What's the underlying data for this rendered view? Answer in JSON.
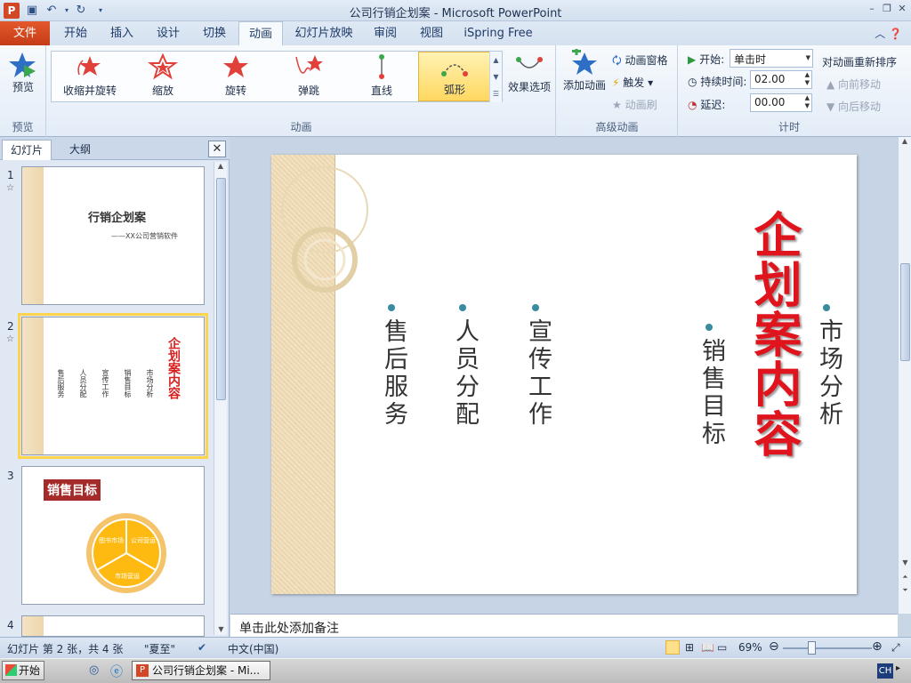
{
  "window": {
    "title": "公司行销企划案 - Microsoft PowerPoint",
    "app_icon_letter": "P",
    "controls": {
      "minimize": "–",
      "restore": "❐",
      "close": "✕"
    }
  },
  "ribbon_tabs": {
    "file": "文件",
    "items": [
      "开始",
      "插入",
      "设计",
      "切换",
      "动画",
      "幻灯片放映",
      "审阅",
      "视图",
      "iSpring Free"
    ],
    "active_index": 4
  },
  "ribbon": {
    "preview": {
      "button": "预览",
      "group": "预览"
    },
    "animation_gallery": {
      "items": [
        {
          "label": "收缩并旋转",
          "icon": "shrink-spin-icon"
        },
        {
          "label": "缩放",
          "icon": "zoom-star-icon"
        },
        {
          "label": "旋转",
          "icon": "spin-star-icon"
        },
        {
          "label": "弹跳",
          "icon": "bounce-star-icon"
        },
        {
          "label": "直线",
          "icon": "line-path-icon"
        },
        {
          "label": "弧形",
          "icon": "arc-path-icon"
        }
      ],
      "selected_index": 5,
      "effect_options": "效果选项",
      "group": "动画"
    },
    "advanced": {
      "add_animation": "添加动画",
      "animation_pane": "动画窗格",
      "trigger": "触发",
      "animation_painter": "动画刷",
      "group": "高级动画"
    },
    "timing": {
      "start_label": "开始:",
      "start_value": "单击时",
      "duration_label": "持续时间:",
      "duration_value": "02.00",
      "delay_label": "延迟:",
      "delay_value": "00.00",
      "reorder_title": "对动画重新排序",
      "move_earlier": "向前移动",
      "move_later": "向后移动",
      "group": "计时"
    }
  },
  "panel": {
    "tab_slides": "幻灯片",
    "tab_outline": "大纲",
    "close": "✕",
    "thumbs": [
      {
        "num": "1",
        "title": "行销企划案",
        "subtitle": "——XX公司营销软件"
      },
      {
        "num": "2",
        "big_title": "企划案内容",
        "columns": [
          "售后服务",
          "人员分配",
          "宣传工作",
          "销售目标",
          "市场分析"
        ]
      },
      {
        "num": "3",
        "title": "销售目标",
        "pie_labels": [
          "图书市场",
          "公司营运",
          "市场营运"
        ]
      },
      {
        "num": "4"
      }
    ],
    "selected_num": "2"
  },
  "slide": {
    "big_title": "企划案内容",
    "columns": [
      "售后服务",
      "人员分配",
      "宣传工作",
      "销售目标",
      "市场分析"
    ]
  },
  "notes_placeholder": "单击此处添加备注",
  "status": {
    "slide_info": "幻灯片 第 2 张，共 4 张",
    "theme": "\"夏至\"",
    "language": "中文(中国)",
    "zoom": "69%"
  },
  "taskbar": {
    "start": "开始",
    "window_button": "公司行销企划案 - Mi...",
    "ime": "CH"
  }
}
